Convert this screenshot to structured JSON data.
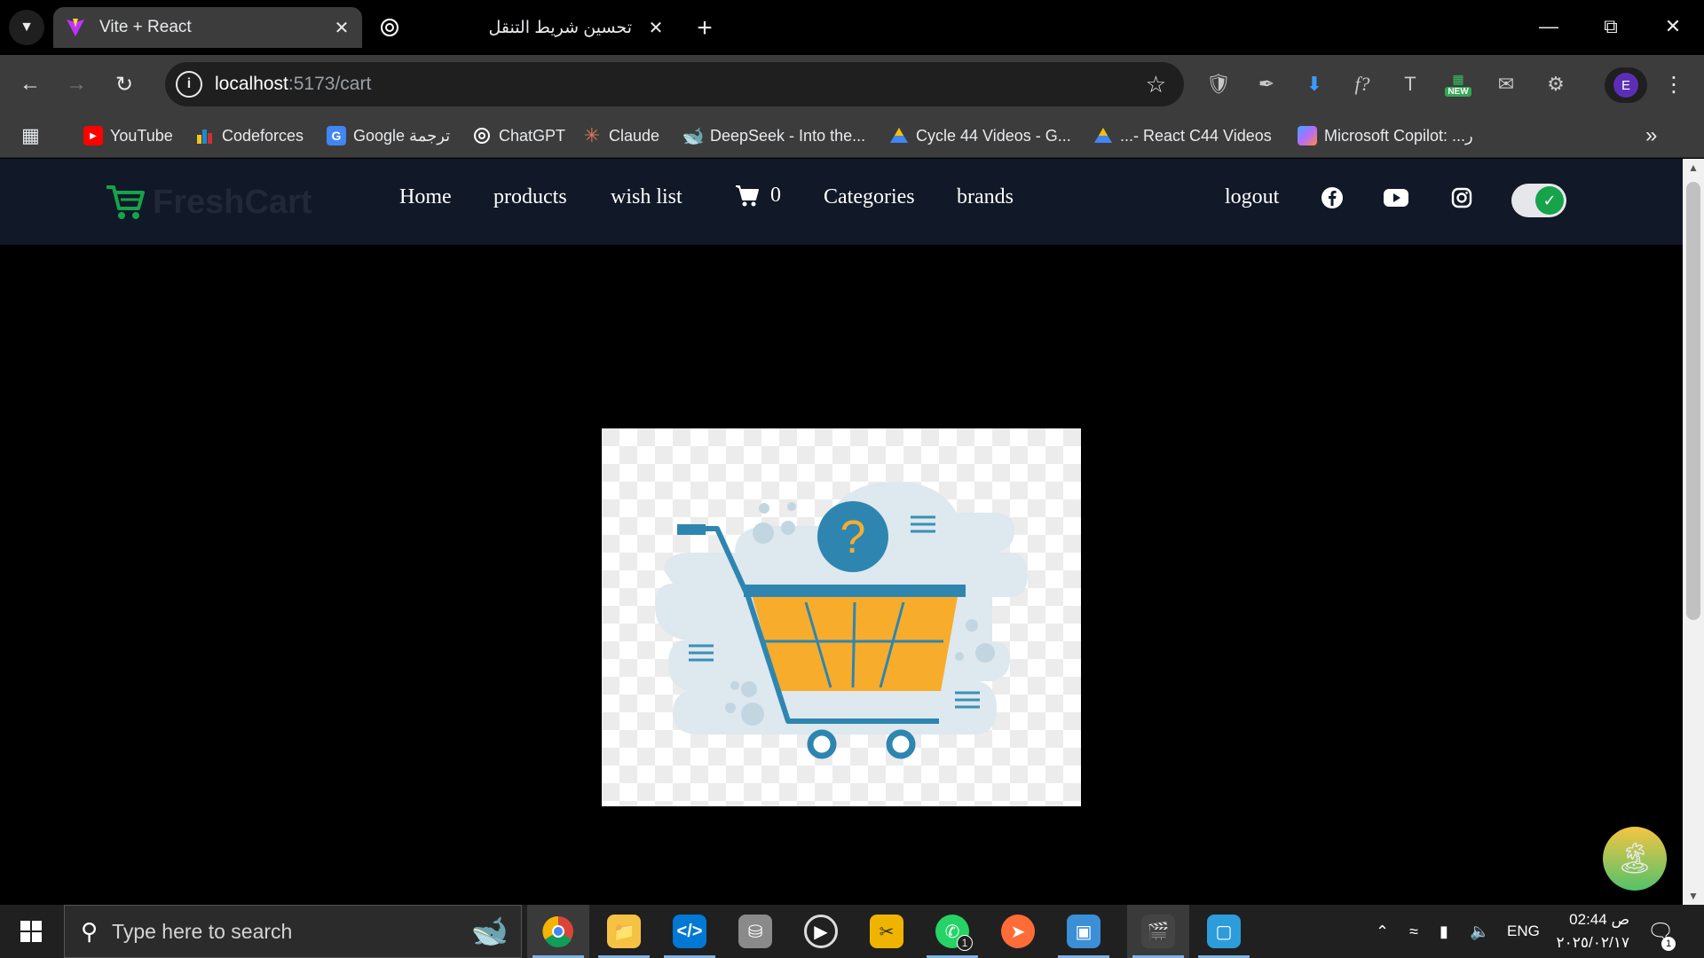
{
  "browser": {
    "tabs": [
      {
        "title": "Vite + React",
        "active": true
      },
      {
        "title": "تحسين شريط التنقل",
        "active": false
      }
    ],
    "url_host": "localhost",
    "url_path": ":5173/cart",
    "profile_initial": "E",
    "ext_badge": "NEW",
    "bookmarks": [
      {
        "label": "YouTube",
        "icon": "youtube-icon",
        "color": "#ff0000"
      },
      {
        "label": "Codeforces",
        "icon": "codeforces-icon",
        "color": "#1f8acb"
      },
      {
        "label": "Google ترجمة",
        "icon": "google-translate-icon",
        "color": "#4285f4"
      },
      {
        "label": "ChatGPT",
        "icon": "chatgpt-icon",
        "color": "#ffffff"
      },
      {
        "label": "Claude",
        "icon": "claude-icon",
        "color": "#d97757"
      },
      {
        "label": "DeepSeek - Into the...",
        "icon": "deepseek-icon",
        "color": "#4d6bfe"
      },
      {
        "label": "Cycle 44 Videos - G...",
        "icon": "google-drive-icon",
        "color": "#34a853"
      },
      {
        "label": "...- React C44 Videos",
        "icon": "google-drive-icon",
        "color": "#34a853"
      },
      {
        "label": "Microsoft Copilot: ...ر",
        "icon": "copilot-icon",
        "color": "#b36bff"
      }
    ]
  },
  "site": {
    "brand": "FreshCart",
    "brand_color": "#16a34a",
    "nav": [
      {
        "label": "Home"
      },
      {
        "label": "products"
      },
      {
        "label": "wish list"
      }
    ],
    "cart_count": "0",
    "nav_right": [
      {
        "label": "Categories"
      },
      {
        "label": "brands"
      }
    ],
    "logout": "logout",
    "social": [
      "facebook-icon",
      "youtube-icon",
      "instagram-icon"
    ],
    "dark_mode_on": true
  },
  "taskbar": {
    "search_placeholder": "Type here to search",
    "lang": "ENG",
    "time": "02:44 ص",
    "date": "٢٠٢٥/٠٢/١٧",
    "whatsapp_badge": "1",
    "notif_count": "1"
  }
}
